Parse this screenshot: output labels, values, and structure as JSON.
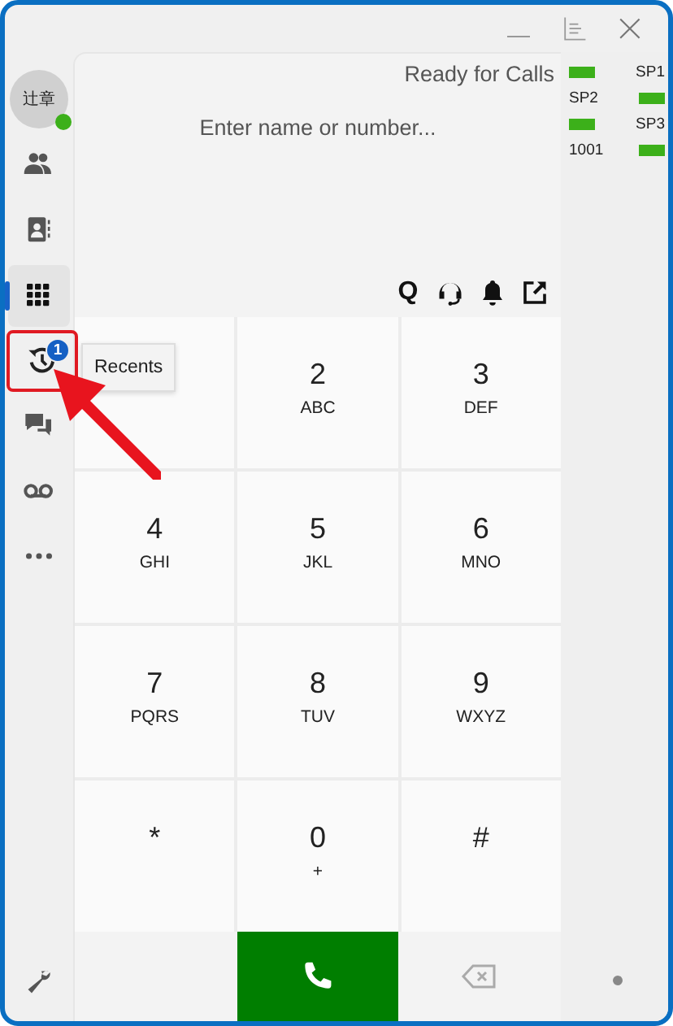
{
  "window": {
    "controls": [
      {
        "kind": "minimize"
      },
      {
        "kind": "layout"
      },
      {
        "kind": "close"
      }
    ]
  },
  "sidebar": {
    "avatar": {
      "initials": "辻章",
      "online": true
    },
    "items": [
      {
        "kind": "contacts",
        "selected": false,
        "highlighted": false
      },
      {
        "kind": "directory",
        "selected": false,
        "highlighted": false
      },
      {
        "kind": "keypad",
        "selected": true,
        "highlighted": false
      },
      {
        "kind": "recents",
        "selected": false,
        "badge": "1",
        "highlighted": true
      },
      {
        "kind": "chat",
        "selected": false,
        "highlighted": false
      },
      {
        "kind": "voicemail",
        "selected": false,
        "highlighted": false
      },
      {
        "kind": "more",
        "selected": false,
        "highlighted": false
      }
    ],
    "footer": {
      "kind": "settings"
    }
  },
  "tooltip": {
    "text": "Recents"
  },
  "annotations": [
    {
      "kind": "arrow"
    }
  ],
  "status": "Ready for Calls",
  "search": {
    "placeholder": "Enter name or number..."
  },
  "toolbar": [
    {
      "kind": "queue",
      "text": "Q"
    },
    {
      "kind": "headset"
    },
    {
      "kind": "bell"
    },
    {
      "kind": "popout"
    }
  ],
  "keypad": [
    {
      "digit": "2",
      "letters": "ABC"
    },
    {
      "digit": "3",
      "letters": "DEF"
    },
    {
      "digit": "4",
      "letters": "GHI"
    },
    {
      "digit": "5",
      "letters": "JKL"
    },
    {
      "digit": "6",
      "letters": "MNO"
    },
    {
      "digit": "7",
      "letters": "PQRS"
    },
    {
      "digit": "8",
      "letters": "TUV"
    },
    {
      "digit": "9",
      "letters": "WXYZ"
    },
    {
      "digit": "*"
    },
    {
      "digit": "0",
      "letters": "+"
    },
    {
      "digit": "#"
    }
  ],
  "bottom_bar": [
    {
      "kind": "empty"
    },
    {
      "kind": "call"
    },
    {
      "kind": "backspace"
    }
  ],
  "speed_dials": [
    {
      "label": "SP1",
      "kind": "label-right",
      "color": "#3cb01a"
    },
    {
      "label": "SP2",
      "kind": "label-left",
      "color": "#3cb01a"
    },
    {
      "label": "SP3",
      "kind": "label-right",
      "color": "#3cb01a"
    },
    {
      "label": "1001",
      "kind": "label-left",
      "color": "#3cb01a"
    }
  ],
  "panel_footer": {
    "kind": "dot"
  }
}
